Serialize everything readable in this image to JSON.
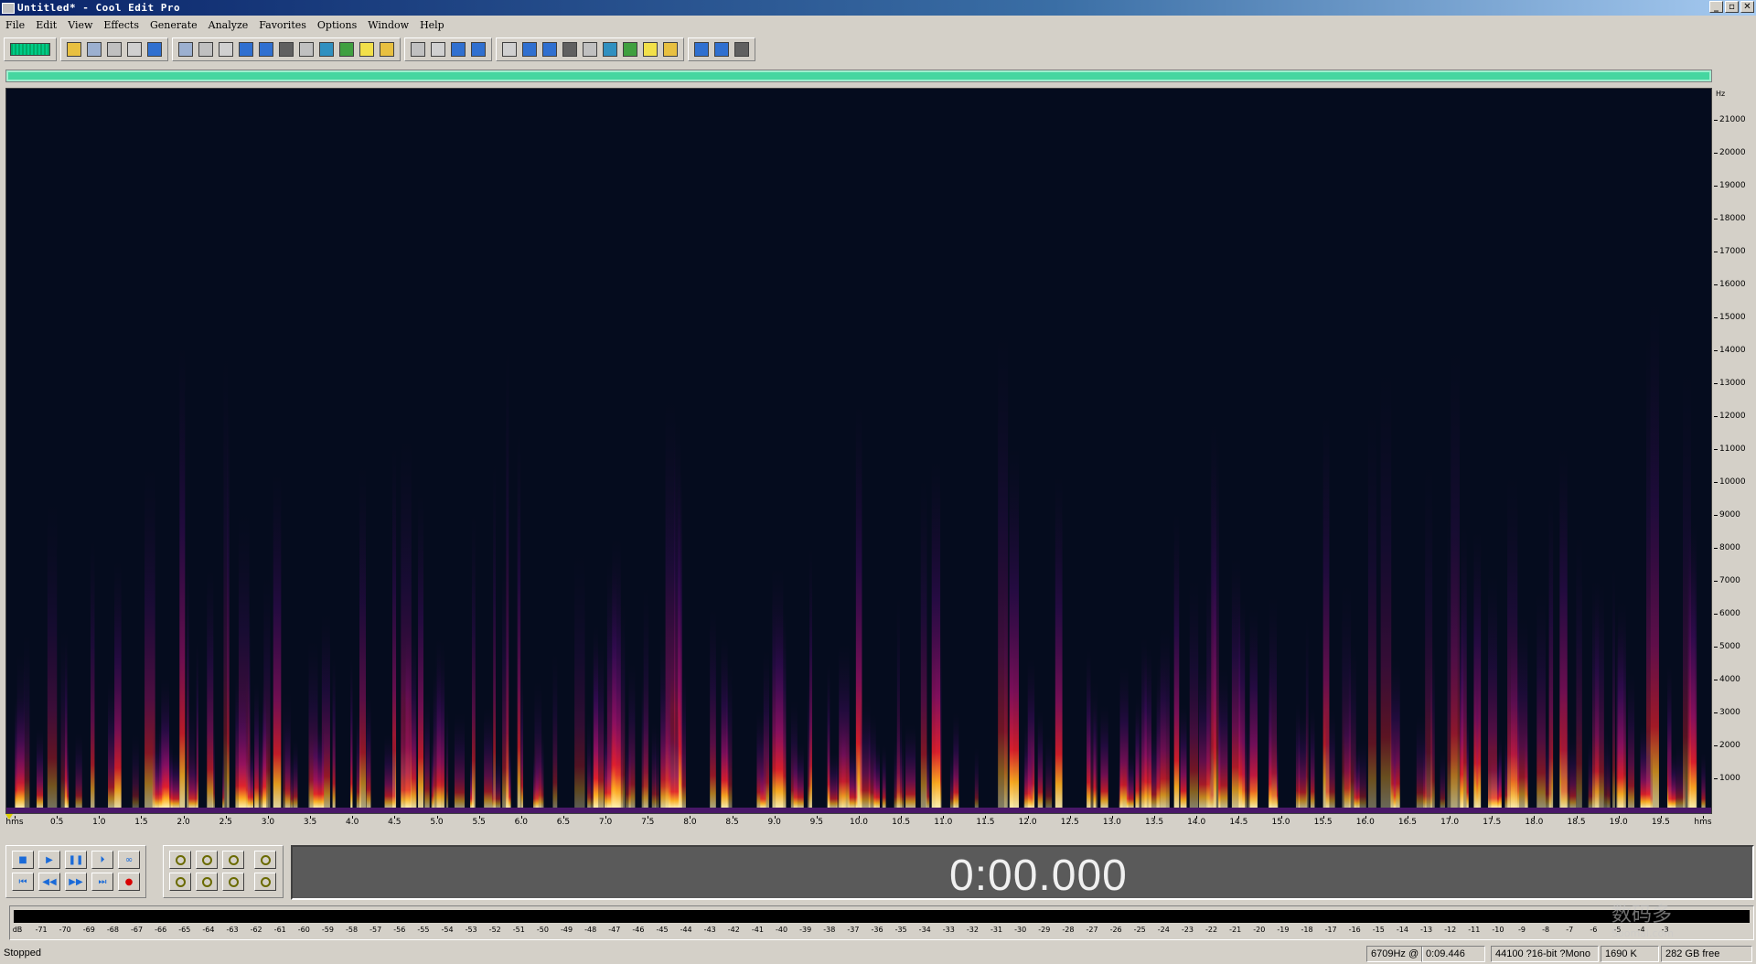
{
  "window": {
    "title": "Untitled* - Cool Edit Pro",
    "controls": [
      "_",
      "▫",
      "✕"
    ]
  },
  "menu": [
    "File",
    "Edit",
    "View",
    "Effects",
    "Generate",
    "Analyze",
    "Favorites",
    "Options",
    "Window",
    "Help"
  ],
  "toolbar": {
    "groups": [
      [
        "multitrack-toggle"
      ],
      [
        "new-icon",
        "open-icon",
        "save-icon",
        "save-all-icon",
        "close-icon"
      ],
      [
        "undo-icon",
        "redo-icon",
        "repeat-icon",
        "copy-to-new-icon",
        "copy-icon",
        "cut-icon",
        "paste-icon",
        "paste-new-icon",
        "mix-paste-icon",
        "crop-icon",
        "trim-icon"
      ],
      [
        "envelope-icon",
        "cue-icon",
        "cue-list-icon",
        "playlist-icon"
      ],
      [
        "waveform-view-icon",
        "spectral-view-icon",
        "frequency-analysis-icon",
        "scripts-icon",
        "zoom-icon",
        "time-format-icon",
        "display-icon",
        "stats-icon",
        "settings-icon"
      ],
      [
        "preferences-icon",
        "properties-icon",
        "help-icon"
      ]
    ]
  },
  "spectrogram": {
    "freq_unit": "Hz",
    "freq_ticks": [
      "21000",
      "20000",
      "19000",
      "18000",
      "17000",
      "16000",
      "15000",
      "14000",
      "13000",
      "12000",
      "11000",
      "10000",
      "9000",
      "8000",
      "7000",
      "6000",
      "5000",
      "4000",
      "3000",
      "2000",
      "1000"
    ],
    "time_ticks": [
      "hms",
      "0.5",
      "1.0",
      "1.5",
      "2.0",
      "2.5",
      "3.0",
      "3.5",
      "4.0",
      "4.5",
      "5.0",
      "5.5",
      "6.0",
      "6.5",
      "7.0",
      "7.5",
      "8.0",
      "8.5",
      "9.0",
      "9.5",
      "10.0",
      "10.5",
      "11.0",
      "11.5",
      "12.0",
      "12.5",
      "13.0",
      "13.5",
      "14.0",
      "14.5",
      "15.0",
      "15.5",
      "16.0",
      "16.5",
      "17.0",
      "17.5",
      "18.0",
      "18.5",
      "19.0",
      "19.5",
      "hms"
    ]
  },
  "transport": {
    "row1": [
      "stop",
      "play",
      "pause",
      "play-to-end",
      "loop"
    ],
    "row1_glyphs": [
      "■",
      "▶",
      "❚❚",
      "⏵",
      "∞"
    ],
    "row2": [
      "go-to-start",
      "rewind",
      "fast-forward",
      "go-to-end",
      "record"
    ],
    "row2_glyphs": [
      "⏮",
      "◀◀",
      "▶▶",
      "⏭",
      "●"
    ],
    "zoom_row1": [
      "zoom-in-horizontal",
      "zoom-out-horizontal",
      "zoom-full",
      "zoom-in-vertical"
    ],
    "zoom_row2": [
      "zoom-to-left",
      "zoom-to-right",
      "zoom-selection",
      "zoom-out-vertical"
    ],
    "time": "0:00.000"
  },
  "level_meter": {
    "labels": [
      "dB",
      "-71",
      "-70",
      "-69",
      "-68",
      "-67",
      "-66",
      "-65",
      "-64",
      "-63",
      "-62",
      "-61",
      "-60",
      "-59",
      "-58",
      "-57",
      "-56",
      "-55",
      "-54",
      "-53",
      "-52",
      "-51",
      "-50",
      "-49",
      "-48",
      "-47",
      "-46",
      "-45",
      "-44",
      "-43",
      "-42",
      "-41",
      "-40",
      "-39",
      "-38",
      "-37",
      "-36",
      "-35",
      "-34",
      "-33",
      "-32",
      "-31",
      "-30",
      "-29",
      "-28",
      "-27",
      "-26",
      "-25",
      "-24",
      "-23",
      "-22",
      "-21",
      "-20",
      "-19",
      "-18",
      "-17",
      "-16",
      "-15",
      "-14",
      "-13",
      "-12",
      "-11",
      "-10",
      "-9",
      "-8",
      "-7",
      "-6",
      "-5",
      "-4",
      "-3"
    ]
  },
  "status": {
    "state": "Stopped",
    "freq_time": "6709Hz @",
    "time_pos": "0:09.446",
    "format": "44100 ?16-bit ?Mono",
    "size": "1690 K",
    "free": "282 GB free"
  },
  "watermark": {
    "main": "数码多",
    "sub": "Soomal.com"
  },
  "colors": {
    "spectrogram_bg": "#050c1e",
    "overview_fill": "#46d6a0",
    "time_display_bg": "#5a5a5a"
  }
}
